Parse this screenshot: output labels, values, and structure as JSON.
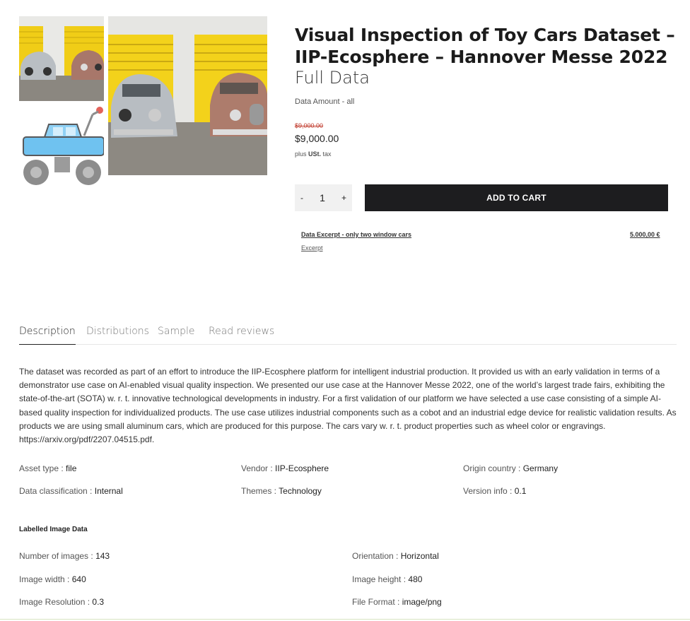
{
  "product": {
    "title": "Visual Inspection of Toy Cars Dataset – IIP-Ecosphere – Hannover Messe 2022",
    "subtitle": "Full Data",
    "amount_label": "Data Amount - all",
    "old_price": "$9,000.00",
    "price": "$9,000.00",
    "tax_prefix": "plus",
    "tax_bold": "USt.",
    "tax_suffix": "tax"
  },
  "cart": {
    "minus": "-",
    "quantity": "1",
    "plus": "+",
    "add_label": "ADD TO CART"
  },
  "excerpt": {
    "link_label": "Data Excerpt - only two window cars",
    "price": "5.000,00 €",
    "sub_label": "Excerpt"
  },
  "tabs": [
    {
      "label": "Description"
    },
    {
      "label": "Distributions"
    },
    {
      "label": "Sample"
    },
    {
      "label": "Read reviews"
    }
  ],
  "description": "The dataset was recorded as part of an effort to introduce the IIP-Ecosphere platform for intelligent industrial production. It provided us with an early validation in terms of a demonstrator use case on AI-enabled visual quality inspection. We presented our use case at the Hannover Messe 2022, one of the world’s largest trade fairs, exhibiting the state-of-the-art (SOTA) w. r. t. innovative technological developments in industry. For a first validation of our platform we have selected a use case consisting of a simple AI-based quality inspection for individualized products. The use case utilizes industrial components such as a cobot and an industrial edge device for realistic validation results. As products we are using small aluminum cars, which are produced for this purpose. The cars vary w. r. t. product properties such as wheel color or engravings. https://arxiv.org/pdf/2207.04515.pdf.",
  "meta": {
    "asset_type": {
      "label": "Asset type :",
      "value": "file"
    },
    "vendor": {
      "label": "Vendor :",
      "value": "IIP-Ecosphere"
    },
    "origin": {
      "label": "Origin country :",
      "value": "Germany"
    },
    "classification": {
      "label": "Data classification :",
      "value": "Internal"
    },
    "themes": {
      "label": "Themes :",
      "value": "Technology"
    },
    "version": {
      "label": "Version info :",
      "value": "0.1"
    }
  },
  "image_data": {
    "heading": "Labelled Image Data",
    "num_images": {
      "label": "Number of images :",
      "value": "143"
    },
    "orientation": {
      "label": "Orientation :",
      "value": "Horizontal"
    },
    "width": {
      "label": "Image width :",
      "value": "640"
    },
    "height": {
      "label": "Image height :",
      "value": "480"
    },
    "resolution": {
      "label": "Image Resolution :",
      "value": "0.3"
    },
    "format": {
      "label": "File Format :",
      "value": "image/png"
    }
  },
  "colors": {
    "button_bg": "#1d1d1f",
    "door_yellow": "#f3d21b",
    "toy_blue": "#6fc2f0",
    "old_price_red": "#c0392b"
  }
}
